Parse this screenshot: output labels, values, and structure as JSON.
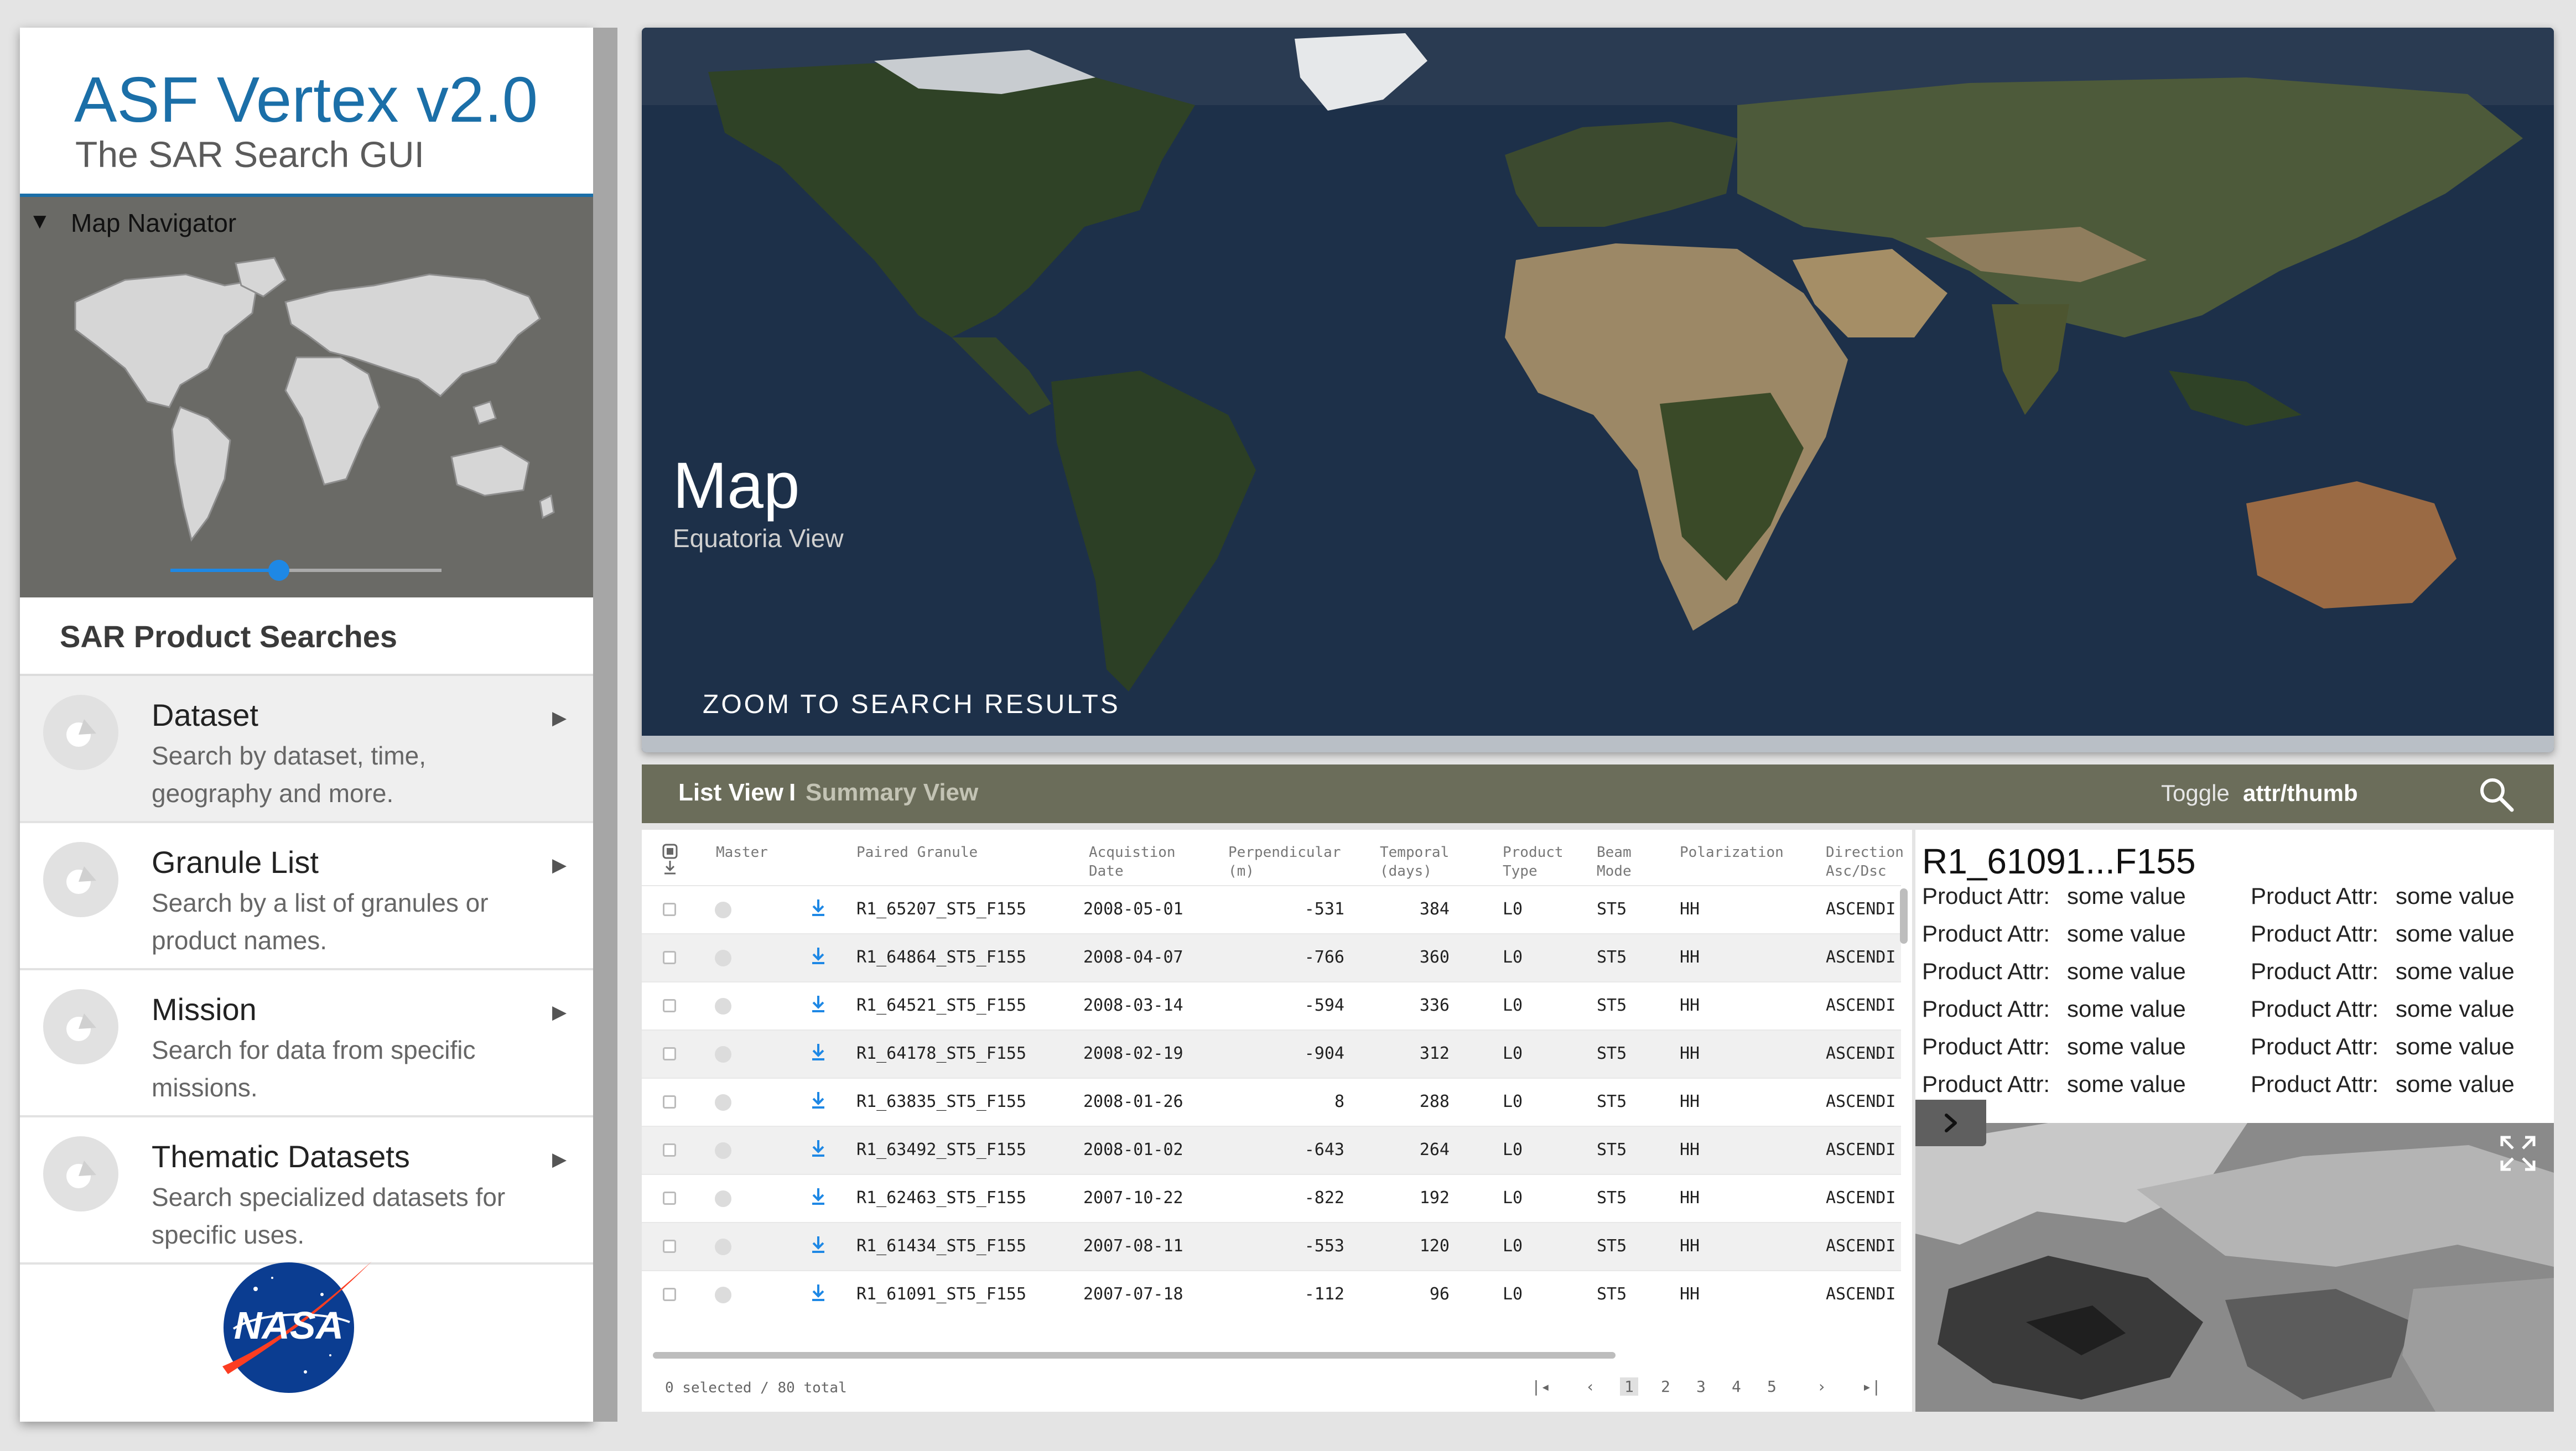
{
  "app": {
    "title": "ASF Vertex v2.0",
    "subtitle": "The SAR Search GUI"
  },
  "map_navigator": {
    "title": "Map Navigator",
    "zoom_level_fraction": 0.4
  },
  "searches": {
    "title": "SAR Product Searches",
    "items": [
      {
        "label": "Dataset",
        "description": "Search by dataset, time, geography and more."
      },
      {
        "label": "Granule List",
        "description": "Search by a list of granules or product names."
      },
      {
        "label": "Mission",
        "description": "Search for data from specific missions."
      },
      {
        "label": "Thematic Datasets",
        "description": "Search specialized datasets for specific uses."
      }
    ]
  },
  "logo": {
    "text": "NASA"
  },
  "map": {
    "title": "Map",
    "subtitle": "Equatoria View",
    "zoom_button": "ZOOM TO SEARCH RESULTS"
  },
  "list_header": {
    "tab_active": "List View",
    "separator": "I",
    "tab_inactive": "Summary View",
    "toggle_label": "Toggle",
    "toggle_value": "attr/thumb"
  },
  "table": {
    "columns": [
      {
        "key": "master",
        "label": "Master"
      },
      {
        "key": "granule",
        "label": "Paired Granule"
      },
      {
        "key": "date",
        "label": "Acquistion\nDate"
      },
      {
        "key": "perp",
        "label": "Perpendicular\n(m)"
      },
      {
        "key": "temporal",
        "label": "Temporal\n(days)"
      },
      {
        "key": "ptype",
        "label": "Product\nType"
      },
      {
        "key": "beam",
        "label": "Beam\nMode"
      },
      {
        "key": "pol",
        "label": "Polarization"
      },
      {
        "key": "dir",
        "label": "Direction\nAsc/Dsc"
      }
    ],
    "rows": [
      {
        "granule": "R1_65207_ST5_F155",
        "date": "2008-05-01",
        "perp": "-531",
        "temporal": "384",
        "ptype": "L0",
        "beam": "ST5",
        "pol": "HH",
        "dir": "ASCENDI"
      },
      {
        "granule": "R1_64864_ST5_F155",
        "date": "2008-04-07",
        "perp": "-766",
        "temporal": "360",
        "ptype": "L0",
        "beam": "ST5",
        "pol": "HH",
        "dir": "ASCENDI"
      },
      {
        "granule": "R1_64521_ST5_F155",
        "date": "2008-03-14",
        "perp": "-594",
        "temporal": "336",
        "ptype": "L0",
        "beam": "ST5",
        "pol": "HH",
        "dir": "ASCENDI"
      },
      {
        "granule": "R1_64178_ST5_F155",
        "date": "2008-02-19",
        "perp": "-904",
        "temporal": "312",
        "ptype": "L0",
        "beam": "ST5",
        "pol": "HH",
        "dir": "ASCENDI"
      },
      {
        "granule": "R1_63835_ST5_F155",
        "date": "2008-01-26",
        "perp": "8",
        "temporal": "288",
        "ptype": "L0",
        "beam": "ST5",
        "pol": "HH",
        "dir": "ASCENDI"
      },
      {
        "granule": "R1_63492_ST5_F155",
        "date": "2008-01-02",
        "perp": "-643",
        "temporal": "264",
        "ptype": "L0",
        "beam": "ST5",
        "pol": "HH",
        "dir": "ASCENDI"
      },
      {
        "granule": "R1_62463_ST5_F155",
        "date": "2007-10-22",
        "perp": "-822",
        "temporal": "192",
        "ptype": "L0",
        "beam": "ST5",
        "pol": "HH",
        "dir": "ASCENDI"
      },
      {
        "granule": "R1_61434_ST5_F155",
        "date": "2007-08-11",
        "perp": "-553",
        "temporal": "120",
        "ptype": "L0",
        "beam": "ST5",
        "pol": "HH",
        "dir": "ASCENDI"
      },
      {
        "granule": "R1_61091_ST5_F155",
        "date": "2007-07-18",
        "perp": "-112",
        "temporal": "96",
        "ptype": "L0",
        "beam": "ST5",
        "pol": "HH",
        "dir": "ASCENDI"
      }
    ],
    "status": "0 selected / 80 total",
    "pages": [
      "1",
      "2",
      "3",
      "4",
      "5"
    ],
    "current_page": "1"
  },
  "detail": {
    "title": "R1_61091...F155",
    "attributes": [
      {
        "label": "Product Attr:",
        "value": "some value"
      },
      {
        "label": "Product Attr:",
        "value": "some value"
      },
      {
        "label": "Product Attr:",
        "value": "some value"
      },
      {
        "label": "Product Attr:",
        "value": "some value"
      },
      {
        "label": "Product Attr:",
        "value": "some value"
      },
      {
        "label": "Product Attr:",
        "value": "some value"
      },
      {
        "label": "Product Attr:",
        "value": "some value"
      },
      {
        "label": "Product Attr:",
        "value": "some value"
      },
      {
        "label": "Product Attr:",
        "value": "some value"
      },
      {
        "label": "Product Attr:",
        "value": "some value"
      },
      {
        "label": "Product Attr:",
        "value": "some value"
      },
      {
        "label": "Product Attr:",
        "value": "some value"
      }
    ]
  },
  "colors": {
    "accent": "#1b6fa8",
    "list_header": "#6b6d5a",
    "slider": "#1e88e5",
    "ocean": "#1d3049",
    "land": "#2f4226",
    "desert": "#9c8866"
  }
}
